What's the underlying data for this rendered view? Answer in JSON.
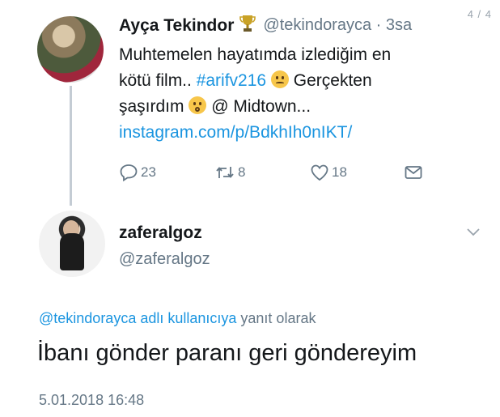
{
  "page_counter": "4 / 4",
  "parent_tweet": {
    "display_name": "Ayça Tekindor",
    "handle": "@tekindorayca",
    "time": "· 3sa",
    "text_line1": "Muhtemelen hayatımda izlediğim en",
    "text_line2_prefix": "kötü film.. ",
    "hashtag": "#arifv216",
    "text_line2_suffix": " Gerçekten",
    "text_line3_prefix": "şaşırdım ",
    "text_line3_suffix": " @ Midtown...",
    "link": "instagram.com/p/BdkhIh0nIKT/",
    "reply_count": "23",
    "retweet_count": "8",
    "like_count": "18",
    "icons": [
      "trophy-icon",
      "reply-icon",
      "retweet-icon",
      "like-icon",
      "dm-icon"
    ]
  },
  "reply_tweet": {
    "display_name": "zaferalgoz",
    "handle": "@zaferalgoz",
    "reply_context_mention": "@tekindorayca adlı kullanıcıya",
    "reply_context_suffix": " yanıt olarak",
    "body": "İbanı gönder paranı geri göndereyim",
    "timestamp": "5.01.2018 16:48"
  },
  "colors": {
    "link": "#1b95e0",
    "secondary_text": "#657786",
    "primary_text": "#14171a",
    "thread_line": "#c4ccd4"
  }
}
